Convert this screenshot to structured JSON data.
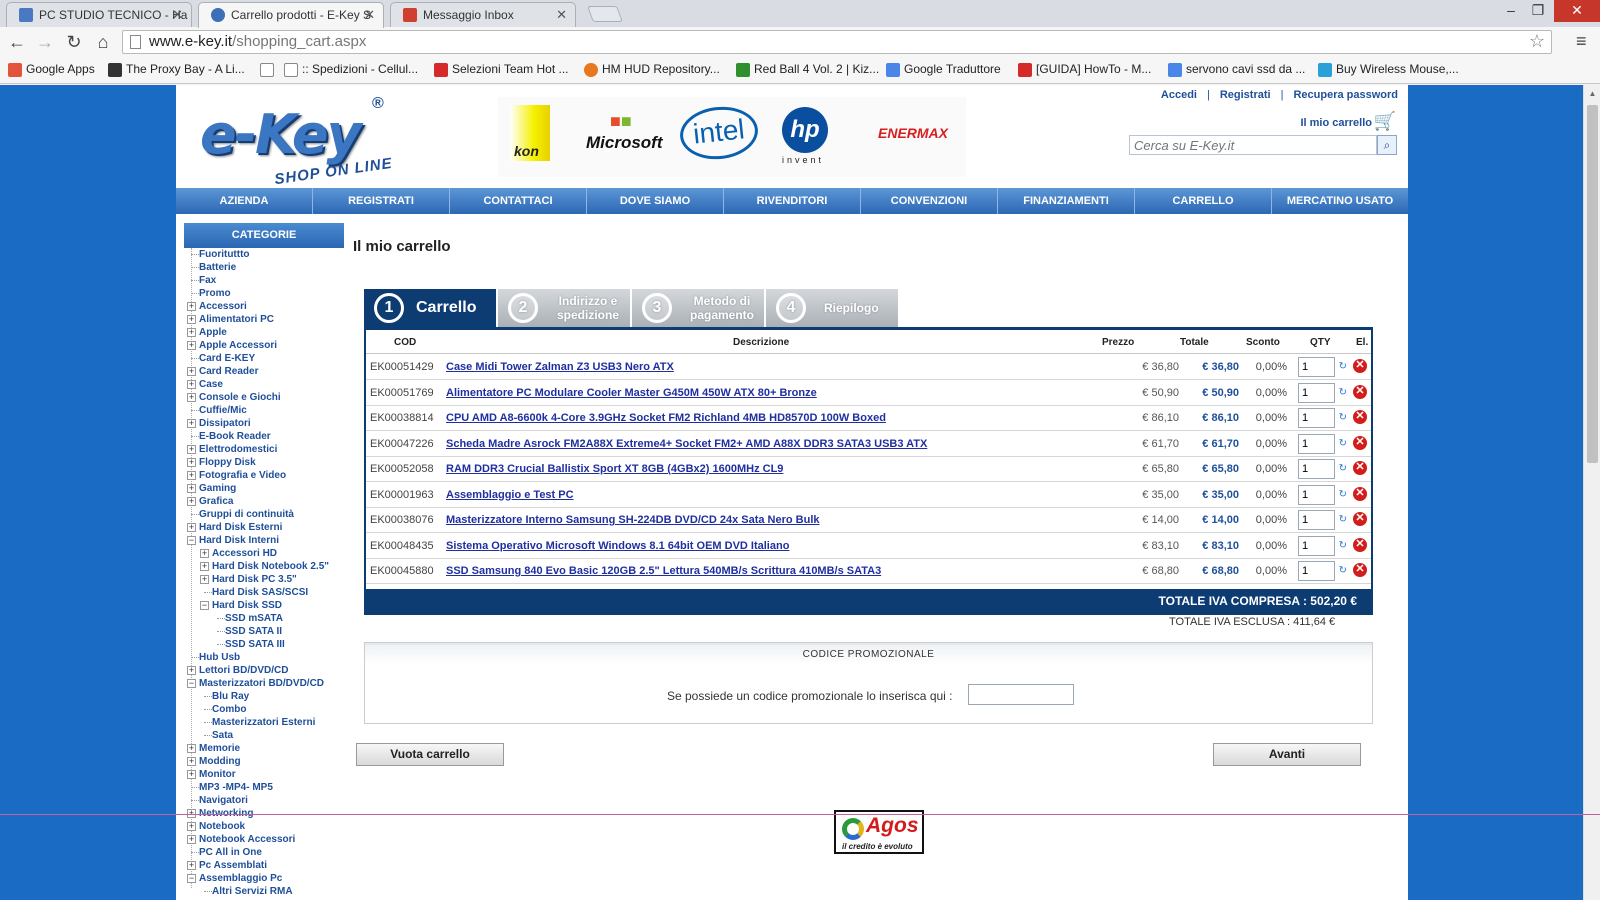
{
  "browser": {
    "tabs": [
      {
        "title": "PC STUDIO TECNICO - Ha",
        "color": "#4a78c2"
      },
      {
        "title": "Carrello prodotti - E-Key S",
        "color": "#3b6fb8"
      },
      {
        "title": "Messaggio Inbox",
        "color": "#d04030"
      }
    ],
    "window_controls": {
      "minimize": "–",
      "maximize": "❐",
      "close": "✕"
    },
    "url_domain": "www.e-key.it",
    "url_path": "/shopping_cart.aspx",
    "bookmarks": [
      {
        "label": "Google Apps",
        "color": "#e2543b"
      },
      {
        "label": "The Proxy Bay - A Li...",
        "color": "#333333"
      },
      {
        "label": "",
        "color": "#ffffff"
      },
      {
        "label": ":: Spedizioni - Cellul...",
        "color": "#ffffff"
      },
      {
        "label": "Selezioni Team Hot ...",
        "color": "#d42a2a"
      },
      {
        "label": "HM HUD Repository...",
        "color": "#e8781f"
      },
      {
        "label": "Red Ball 4 Vol. 2 | Kiz...",
        "color": "#2f8f2f"
      },
      {
        "label": "Google Traduttore",
        "color": "#4a86e8"
      },
      {
        "label": "[GUIDA] HowTo - M...",
        "color": "#d42a2a"
      },
      {
        "label": "servono cavi ssd da ...",
        "color": "#4a86e8"
      },
      {
        "label": "Buy Wireless Mouse,...",
        "color": "#2aa0d8"
      }
    ]
  },
  "header": {
    "logo_main": "e-Key",
    "logo_reg": "®",
    "logo_sub": "SHOP ON LINE",
    "brands": [
      "kon",
      "Microsoft",
      "intel",
      "hp",
      "invent",
      "ENERMAX"
    ],
    "links": [
      "Accedi",
      "Registrati",
      "Recupera password"
    ],
    "link_sep": "|",
    "cart_link": "Il mio carrello",
    "search_placeholder": "Cerca su E-Key.it"
  },
  "nav": [
    "AZIENDA",
    "REGISTRATI",
    "CONTATTACI",
    "DOVE SIAMO",
    "RIVENDITORI",
    "CONVENZIONI",
    "FINANZIAMENTI",
    "CARRELLO",
    "MERCATINO USATO"
  ],
  "sidebar": {
    "title": "CATEGORIE",
    "items": [
      {
        "label": "Fuorituttto",
        "level": 0,
        "exp": ""
      },
      {
        "label": "Batterie",
        "level": 0,
        "exp": ""
      },
      {
        "label": "Fax",
        "level": 0,
        "exp": ""
      },
      {
        "label": "Promo",
        "level": 0,
        "exp": ""
      },
      {
        "label": "Accessori",
        "level": 0,
        "exp": "+"
      },
      {
        "label": "Alimentatori PC",
        "level": 0,
        "exp": "+"
      },
      {
        "label": "Apple",
        "level": 0,
        "exp": "+"
      },
      {
        "label": "Apple Accessori",
        "level": 0,
        "exp": "+"
      },
      {
        "label": "Card E-KEY",
        "level": 0,
        "exp": ""
      },
      {
        "label": "Card Reader",
        "level": 0,
        "exp": "+"
      },
      {
        "label": "Case",
        "level": 0,
        "exp": "+"
      },
      {
        "label": "Console e Giochi",
        "level": 0,
        "exp": "+"
      },
      {
        "label": "Cuffie/Mic",
        "level": 0,
        "exp": ""
      },
      {
        "label": "Dissipatori",
        "level": 0,
        "exp": "+"
      },
      {
        "label": "E-Book Reader",
        "level": 0,
        "exp": ""
      },
      {
        "label": "Elettrodomestici",
        "level": 0,
        "exp": "+"
      },
      {
        "label": "Floppy Disk",
        "level": 0,
        "exp": "+"
      },
      {
        "label": "Fotografia e Video",
        "level": 0,
        "exp": "+"
      },
      {
        "label": "Gaming",
        "level": 0,
        "exp": "+"
      },
      {
        "label": "Grafica",
        "level": 0,
        "exp": "+"
      },
      {
        "label": "Gruppi di continuità",
        "level": 0,
        "exp": ""
      },
      {
        "label": "Hard Disk Esterni",
        "level": 0,
        "exp": "+"
      },
      {
        "label": "Hard Disk Interni",
        "level": 0,
        "exp": "−"
      },
      {
        "label": "Accessori HD",
        "level": 1,
        "exp": "+"
      },
      {
        "label": "Hard Disk Notebook 2.5\"",
        "level": 1,
        "exp": "+"
      },
      {
        "label": "Hard Disk PC 3.5\"",
        "level": 1,
        "exp": "+"
      },
      {
        "label": "Hard Disk SAS/SCSI",
        "level": 1,
        "exp": ""
      },
      {
        "label": "Hard Disk SSD",
        "level": 1,
        "exp": "−"
      },
      {
        "label": "SSD mSATA",
        "level": 2,
        "exp": ""
      },
      {
        "label": "SSD SATA II",
        "level": 2,
        "exp": ""
      },
      {
        "label": "SSD SATA III",
        "level": 2,
        "exp": ""
      },
      {
        "label": "Hub Usb",
        "level": 0,
        "exp": ""
      },
      {
        "label": "Lettori BD/DVD/CD",
        "level": 0,
        "exp": "+"
      },
      {
        "label": "Masterizzatori BD/DVD/CD",
        "level": 0,
        "exp": "−"
      },
      {
        "label": "Blu Ray",
        "level": 1,
        "exp": ""
      },
      {
        "label": "Combo",
        "level": 1,
        "exp": ""
      },
      {
        "label": "Masterizzatori Esterni",
        "level": 1,
        "exp": ""
      },
      {
        "label": "Sata",
        "level": 1,
        "exp": ""
      },
      {
        "label": "Memorie",
        "level": 0,
        "exp": "+"
      },
      {
        "label": "Modding",
        "level": 0,
        "exp": "+"
      },
      {
        "label": "Monitor",
        "level": 0,
        "exp": "+"
      },
      {
        "label": "MP3 -MP4- MP5",
        "level": 0,
        "exp": ""
      },
      {
        "label": "Navigatori",
        "level": 0,
        "exp": ""
      },
      {
        "label": "Networking",
        "level": 0,
        "exp": "+"
      },
      {
        "label": "Notebook",
        "level": 0,
        "exp": "+"
      },
      {
        "label": "Notebook Accessori",
        "level": 0,
        "exp": "+"
      },
      {
        "label": "PC All in One",
        "level": 0,
        "exp": ""
      },
      {
        "label": "Pc Assemblati",
        "level": 0,
        "exp": "+"
      },
      {
        "label": "Assemblaggio Pc",
        "level": 0,
        "exp": "−"
      },
      {
        "label": "Altri Servizi RMA",
        "level": 1,
        "exp": ""
      }
    ]
  },
  "main": {
    "title": "Il mio carrello",
    "steps": [
      {
        "num": "1",
        "label": "Carrello",
        "active": true
      },
      {
        "num": "2",
        "label": "Indirizzo e spedizione",
        "active": false
      },
      {
        "num": "3",
        "label": "Metodo di pagamento",
        "active": false
      },
      {
        "num": "4",
        "label": "Riepilogo",
        "active": false
      }
    ],
    "columns": {
      "cod": "COD",
      "desc": "Descrizione",
      "price": "Prezzo",
      "total": "Totale",
      "disc": "Sconto",
      "qty": "QTY",
      "del": "El."
    },
    "rows": [
      {
        "cod": "EK00051429",
        "desc": "Case Midi Tower Zalman Z3 USB3 Nero ATX",
        "price": "€ 36,80",
        "total": "€ 36,80",
        "disc": "0,00%",
        "qty": "1"
      },
      {
        "cod": "EK00051769",
        "desc": "Alimentatore PC Modulare Cooler Master G450M 450W ATX 80+ Bronze",
        "price": "€ 50,90",
        "total": "€ 50,90",
        "disc": "0,00%",
        "qty": "1"
      },
      {
        "cod": "EK00038814",
        "desc": "CPU AMD A8-6600k 4-Core 3.9GHz Socket FM2 Richland 4MB HD8570D 100W Boxed",
        "price": "€ 86,10",
        "total": "€ 86,10",
        "disc": "0,00%",
        "qty": "1"
      },
      {
        "cod": "EK00047226",
        "desc": "Scheda Madre Asrock FM2A88X Extreme4+ Socket FM2+ AMD A88X DDR3 SATA3 USB3 ATX",
        "price": "€ 61,70",
        "total": "€ 61,70",
        "disc": "0,00%",
        "qty": "1"
      },
      {
        "cod": "EK00052058",
        "desc": "RAM DDR3 Crucial Ballistix Sport XT 8GB (4GBx2) 1600MHz CL9",
        "price": "€ 65,80",
        "total": "€ 65,80",
        "disc": "0,00%",
        "qty": "1"
      },
      {
        "cod": "EK00001963",
        "desc": "Assemblaggio e Test PC",
        "price": "€ 35,00",
        "total": "€ 35,00",
        "disc": "0,00%",
        "qty": "1"
      },
      {
        "cod": "EK00038076",
        "desc": "Masterizzatore Interno Samsung SH-224DB DVD/CD 24x Sata Nero Bulk",
        "price": "€ 14,00",
        "total": "€ 14,00",
        "disc": "0,00%",
        "qty": "1"
      },
      {
        "cod": "EK00048435",
        "desc": "Sistema Operativo Microsoft Windows 8.1 64bit OEM DVD Italiano",
        "price": "€ 83,10",
        "total": "€ 83,10",
        "disc": "0,00%",
        "qty": "1"
      },
      {
        "cod": "EK00045880",
        "desc": "SSD Samsung 840 Evo Basic 120GB 2.5\" Lettura 540MB/s Scrittura 410MB/s SATA3",
        "price": "€ 68,80",
        "total": "€ 68,80",
        "disc": "0,00%",
        "qty": "1"
      }
    ],
    "total_incl": "TOTALE IVA COMPRESA : 502,20 €",
    "total_excl": "TOTALE IVA ESCLUSA : 411,64 €",
    "promo_title": "CODICE PROMOZIONALE",
    "promo_label": "Se possiede un codice promozionale lo inserisca qui :",
    "btn_empty": "Vuota carrello",
    "btn_next": "Avanti",
    "agos_title": "Agos",
    "agos_sub": "il credito è evoluto"
  },
  "colors": {
    "site_bg": "#1a6bc4",
    "nav": "#2b67b4",
    "dark_blue": "#0d3c73",
    "link": "#1f4f99"
  }
}
